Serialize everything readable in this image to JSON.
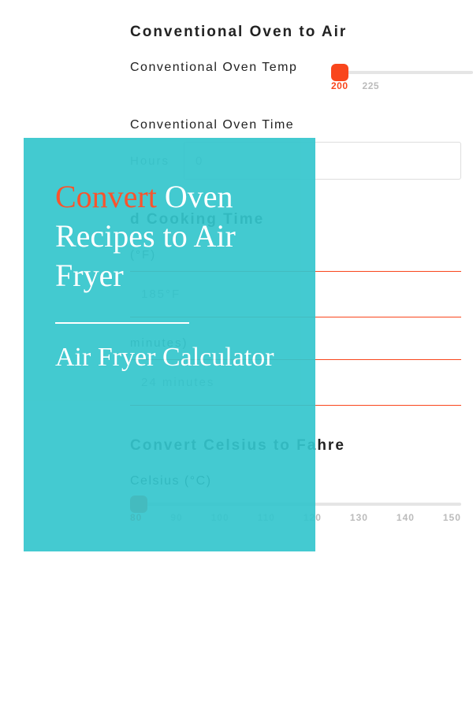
{
  "header": {
    "title": "Conventional Oven to Air"
  },
  "oven_temp": {
    "label": "Conventional Oven Temp",
    "ticks": [
      "200",
      "225"
    ],
    "active_index": 0
  },
  "oven_time": {
    "label": "Conventional Oven Time",
    "hours_label": "Hours",
    "hours_value": "0"
  },
  "reco": {
    "title_tail": "d Cooking Time",
    "temp_label_tail": " (°F)",
    "temp_value": "185°F",
    "time_label_tail": "minutes)",
    "time_value": "24 minutes"
  },
  "celsius_section": {
    "title": "Convert Celsius to Fahre",
    "label": "Celsius (°C)",
    "ticks": [
      "80",
      "90",
      "100",
      "110",
      "120",
      "130",
      "140",
      "150"
    ],
    "active_index": 0
  },
  "overlay": {
    "highlight": "Convert",
    "rest": "Oven Recipes to Air Fryer",
    "sub": "Air Fryer Calculator"
  }
}
